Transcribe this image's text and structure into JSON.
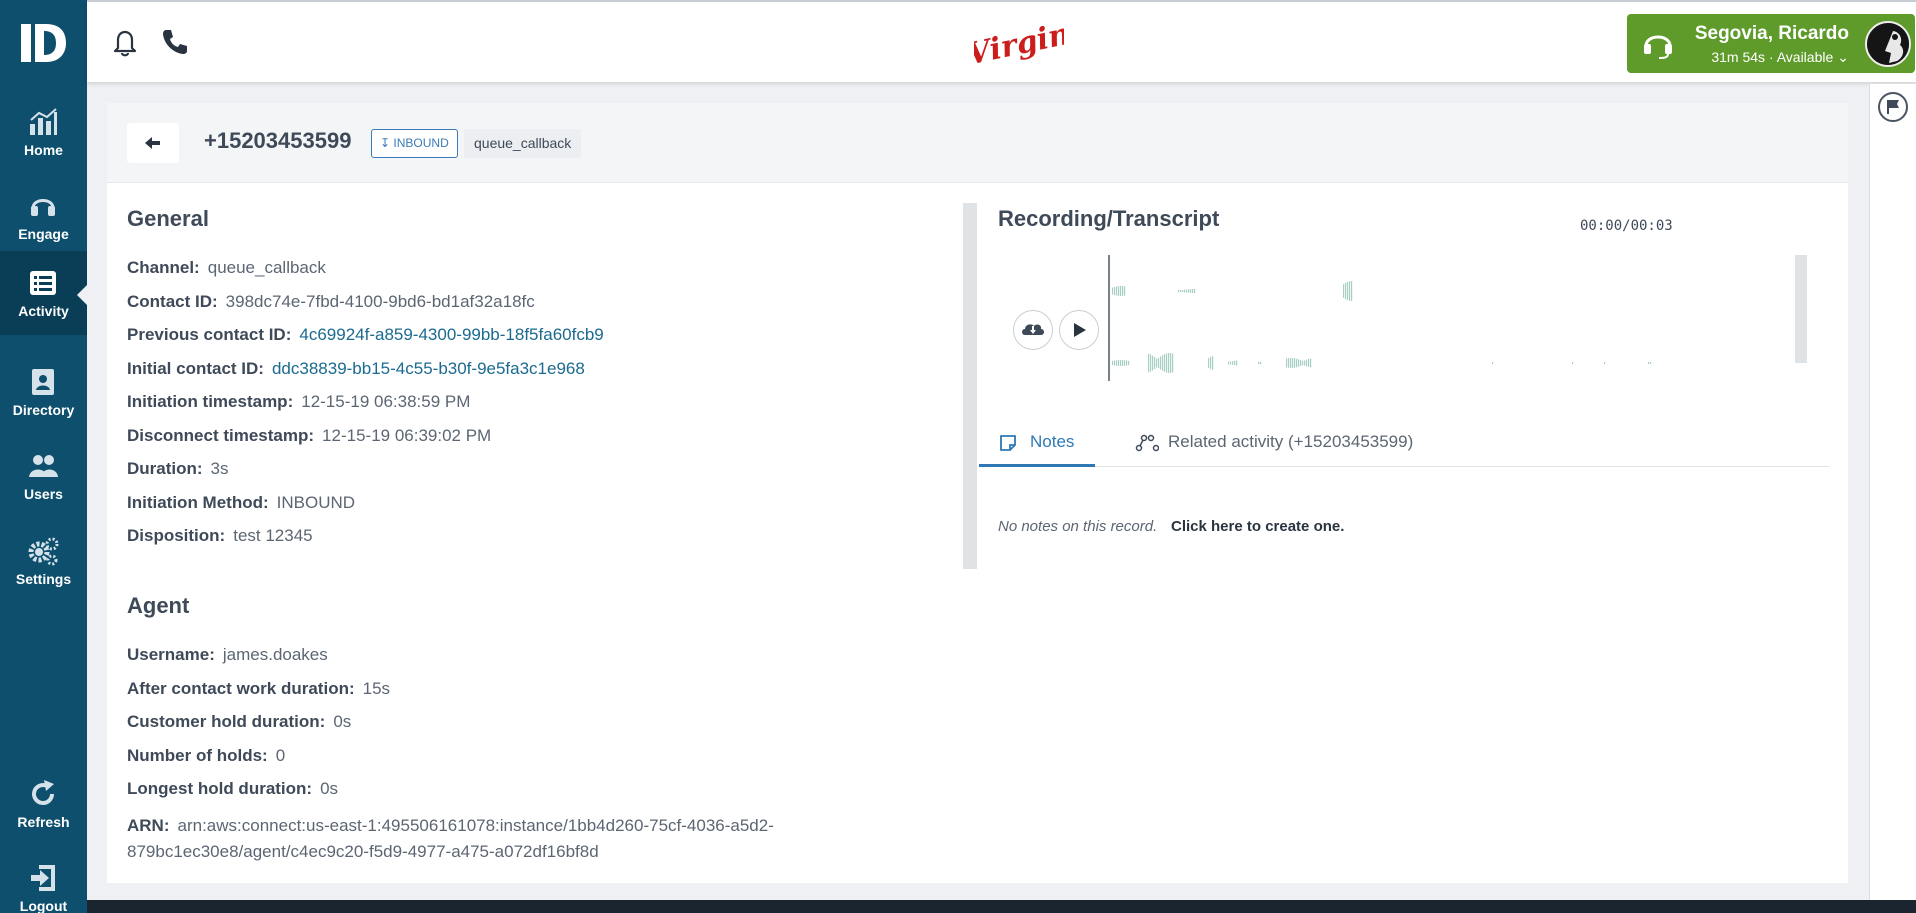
{
  "sidebar": {
    "items": [
      {
        "label": "Home",
        "icon": "bar-chart-icon"
      },
      {
        "label": "Engage",
        "icon": "headset-icon"
      },
      {
        "label": "Activity",
        "icon": "list-icon"
      },
      {
        "label": "Directory",
        "icon": "contact-book-icon"
      },
      {
        "label": "Users",
        "icon": "users-icon"
      },
      {
        "label": "Settings",
        "icon": "gears-icon"
      }
    ],
    "refresh": "Refresh",
    "logout": "Logout"
  },
  "topbar": {
    "brand": "Virgin",
    "agent_name": "Segovia, Ricardo",
    "agent_status": "31m 54s · Available",
    "status_color": "#5f9b2a"
  },
  "record": {
    "phone": "+15203453599",
    "direction_tag": "INBOUND",
    "queue_tag": "queue_callback"
  },
  "general": {
    "title": "General",
    "channel_label": "Channel:",
    "channel": "queue_callback",
    "contact_id_label": "Contact ID:",
    "contact_id": "398dc74e-7fbd-4100-9bd6-bd1af32a18fc",
    "prev_id_label": "Previous contact ID:",
    "prev_id": "4c69924f-a859-4300-99bb-18f5fa60fcb9",
    "init_id_label": "Initial contact ID:",
    "init_id": "ddc38839-bb15-4c55-b30f-9e5fa3c1e968",
    "init_ts_label": "Initiation timestamp:",
    "init_ts": "12-15-19 06:38:59 PM",
    "disc_ts_label": "Disconnect timestamp:",
    "disc_ts": "12-15-19 06:39:02 PM",
    "duration_label": "Duration:",
    "duration": "3s",
    "method_label": "Initiation Method:",
    "method": "INBOUND",
    "disposition_label": "Disposition:",
    "disposition": "test 12345"
  },
  "agent": {
    "title": "Agent",
    "username_label": "Username:",
    "username": "james.doakes",
    "acw_label": "After contact work duration:",
    "acw": "15s",
    "hold_label": "Customer hold duration:",
    "hold": "0s",
    "holds_label": "Number of holds:",
    "holds": "0",
    "longest_label": "Longest hold duration:",
    "longest": "0s",
    "arn_label": "ARN:",
    "arn": "arn:aws:connect:us-east-1:495506161078:instance/1bb4d260-75cf-4036-a5d2-879bc1ec30e8/agent/c4ec9c20-f5d9-4977-a475-a072df16bf8d"
  },
  "recording": {
    "title": "Recording/Transcript",
    "time": "00:00/00:03",
    "wave_color": "#a8cfc6",
    "tabs": [
      {
        "label": "Notes"
      },
      {
        "label": "Related activity (+15203453599)"
      }
    ],
    "no_notes": "No notes on this record.",
    "create_link": "Click here to create one."
  }
}
